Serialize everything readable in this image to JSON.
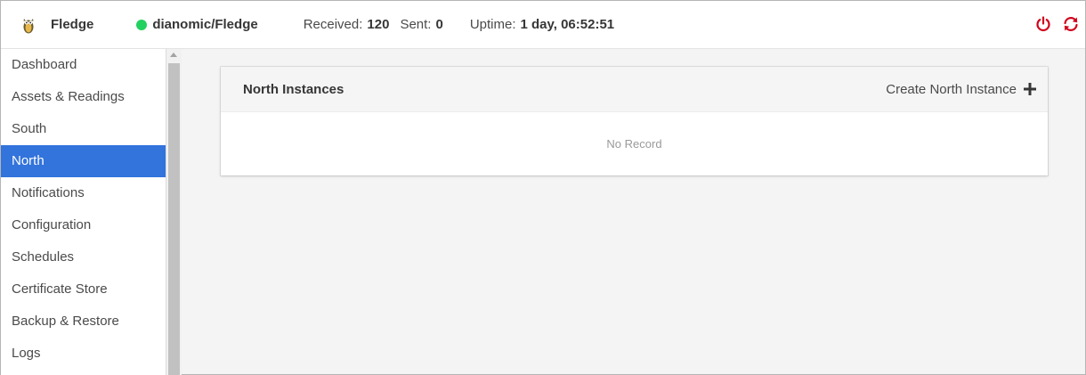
{
  "navbar": {
    "brand_name": "Fledge",
    "logo_icon": "owl-logo-icon",
    "instance_name": "dianomic/Fledge",
    "status_color": "#23d160",
    "received_label": "Received:",
    "received_value": "120",
    "sent_label": "Sent:",
    "sent_value": "0",
    "uptime_label": "Uptime:",
    "uptime_value": "1 day, 06:52:51",
    "icons": [
      "power-icon",
      "refresh-icon"
    ],
    "icon_color": "#d0021b"
  },
  "sidebar": {
    "items": [
      {
        "label": "Dashboard"
      },
      {
        "label": "Assets & Readings"
      },
      {
        "label": "South"
      },
      {
        "label": "North",
        "active": true
      },
      {
        "label": "Notifications"
      },
      {
        "label": "Configuration"
      },
      {
        "label": "Schedules"
      },
      {
        "label": "Certificate Store"
      },
      {
        "label": "Backup & Restore"
      },
      {
        "label": "Logs"
      }
    ],
    "active_color": "#3273dc"
  },
  "main": {
    "card_title": "North Instances",
    "create_label": "Create North Instance",
    "create_icon": "plus-icon",
    "empty_text": "No Record"
  }
}
